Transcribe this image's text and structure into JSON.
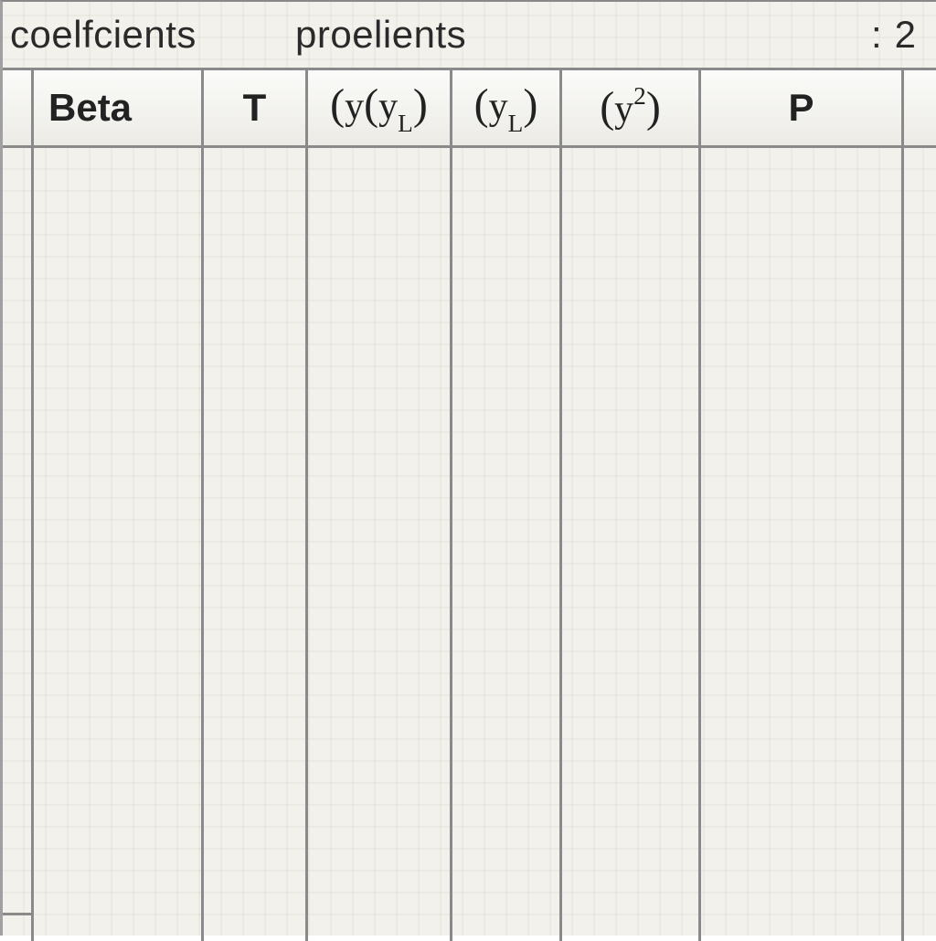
{
  "toolbar": {
    "tab_coefficients": "coelfcients",
    "tab_proelients": "proelients",
    "counter_prefix": ":",
    "counter_value": "2"
  },
  "columns": {
    "row_handle": "",
    "beta": "Beta",
    "t": "T",
    "yyl": {
      "open": "(",
      "y1": "y",
      "open2": "(",
      "y2": "y",
      "sub": "L",
      "close2": ")",
      "close": ""
    },
    "yl": {
      "open": "(",
      "y": "y",
      "sub": "L",
      "close": ")"
    },
    "y2": {
      "open": "(",
      "y": "y",
      "sup": "2",
      "close": ")"
    },
    "p": "P",
    "last": " "
  },
  "rows": []
}
